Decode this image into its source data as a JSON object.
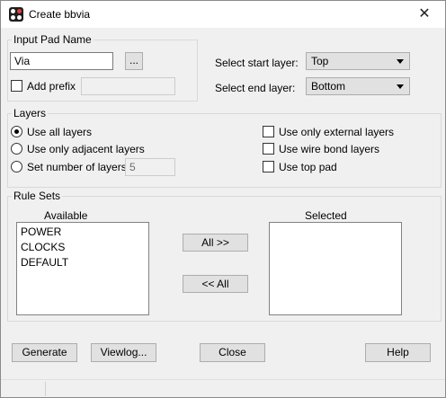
{
  "window": {
    "title": "Create bbvia",
    "close_glyph": "✕",
    "app_icon": "app-icon"
  },
  "input_pad": {
    "group_label": "Input Pad Name",
    "pad_value": "Via",
    "browse_label": "...",
    "add_prefix_label": "Add prefix",
    "add_prefix_checked": false,
    "prefix_value": ""
  },
  "layer_select": {
    "start_label": "Select start layer:",
    "start_value": "Top",
    "end_label": "Select end layer:",
    "end_value": "Bottom"
  },
  "layers": {
    "group_label": "Layers",
    "use_all": "Use all layers",
    "use_adjacent": "Use only adjacent layers",
    "set_number": "Set number of layers",
    "number_value": "5",
    "selected_option": "use_all",
    "use_external": "Use only external layers",
    "use_wire_bond": "Use wire bond layers",
    "use_top_pad": "Use top pad"
  },
  "rule_sets": {
    "group_label": "Rule Sets",
    "available_label": "Available",
    "available_items": [
      "POWER",
      "CLOCKS",
      "DEFAULT"
    ],
    "selected_label": "Selected",
    "selected_items": [],
    "all_right_label": "All >>",
    "all_left_label": "<< All"
  },
  "buttons": {
    "generate": "Generate",
    "viewlog": "Viewlog...",
    "close": "Close",
    "help": "Help"
  }
}
